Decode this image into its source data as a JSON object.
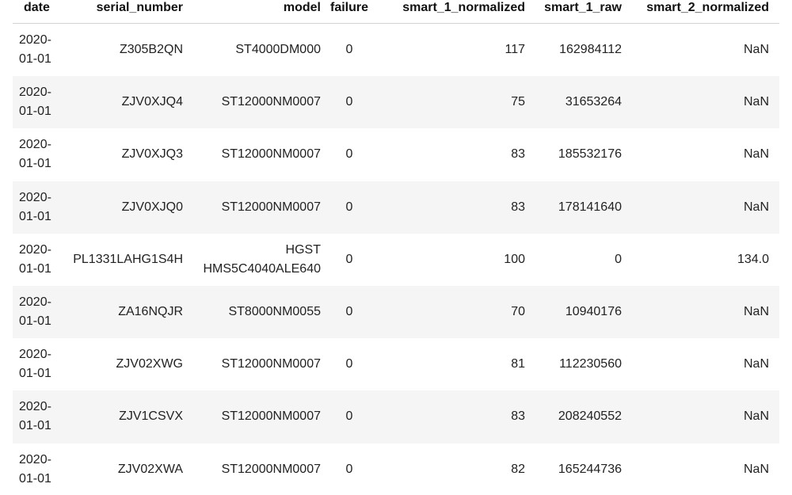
{
  "table": {
    "columns": [
      "date",
      "serial_number",
      "model",
      "failure",
      "smart_1_normalized",
      "smart_1_raw",
      "smart_2_normalized"
    ],
    "rows": [
      {
        "date_1": "2020-",
        "date_2": "01-01",
        "serial_number": "Z305B2QN",
        "model": "ST4000DM000",
        "failure": "0",
        "smart_1_normalized": "117",
        "smart_1_raw": "162984112",
        "smart_2_normalized": "NaN"
      },
      {
        "date_1": "2020-",
        "date_2": "01-01",
        "serial_number": "ZJV0XJQ4",
        "model": "ST12000NM0007",
        "failure": "0",
        "smart_1_normalized": "75",
        "smart_1_raw": "31653264",
        "smart_2_normalized": "NaN"
      },
      {
        "date_1": "2020-",
        "date_2": "01-01",
        "serial_number": "ZJV0XJQ3",
        "model": "ST12000NM0007",
        "failure": "0",
        "smart_1_normalized": "83",
        "smart_1_raw": "185532176",
        "smart_2_normalized": "NaN"
      },
      {
        "date_1": "2020-",
        "date_2": "01-01",
        "serial_number": "ZJV0XJQ0",
        "model": "ST12000NM0007",
        "failure": "0",
        "smart_1_normalized": "83",
        "smart_1_raw": "178141640",
        "smart_2_normalized": "NaN"
      },
      {
        "date_1": "2020-",
        "date_2": "01-01",
        "serial_number": "PL1331LAHG1S4H",
        "model": "HGST HMS5C4040ALE640",
        "failure": "0",
        "smart_1_normalized": "100",
        "smart_1_raw": "0",
        "smart_2_normalized": "134.0"
      },
      {
        "date_1": "2020-",
        "date_2": "01-01",
        "serial_number": "ZA16NQJR",
        "model": "ST8000NM0055",
        "failure": "0",
        "smart_1_normalized": "70",
        "smart_1_raw": "10940176",
        "smart_2_normalized": "NaN"
      },
      {
        "date_1": "2020-",
        "date_2": "01-01",
        "serial_number": "ZJV02XWG",
        "model": "ST12000NM0007",
        "failure": "0",
        "smart_1_normalized": "81",
        "smart_1_raw": "112230560",
        "smart_2_normalized": "NaN"
      },
      {
        "date_1": "2020-",
        "date_2": "01-01",
        "serial_number": "ZJV1CSVX",
        "model": "ST12000NM0007",
        "failure": "0",
        "smart_1_normalized": "83",
        "smart_1_raw": "208240552",
        "smart_2_normalized": "NaN"
      },
      {
        "date_1": "2020-",
        "date_2": "01-01",
        "serial_number": "ZJV02XWA",
        "model": "ST12000NM0007",
        "failure": "0",
        "smart_1_normalized": "82",
        "smart_1_raw": "165244736",
        "smart_2_normalized": "NaN"
      }
    ]
  }
}
